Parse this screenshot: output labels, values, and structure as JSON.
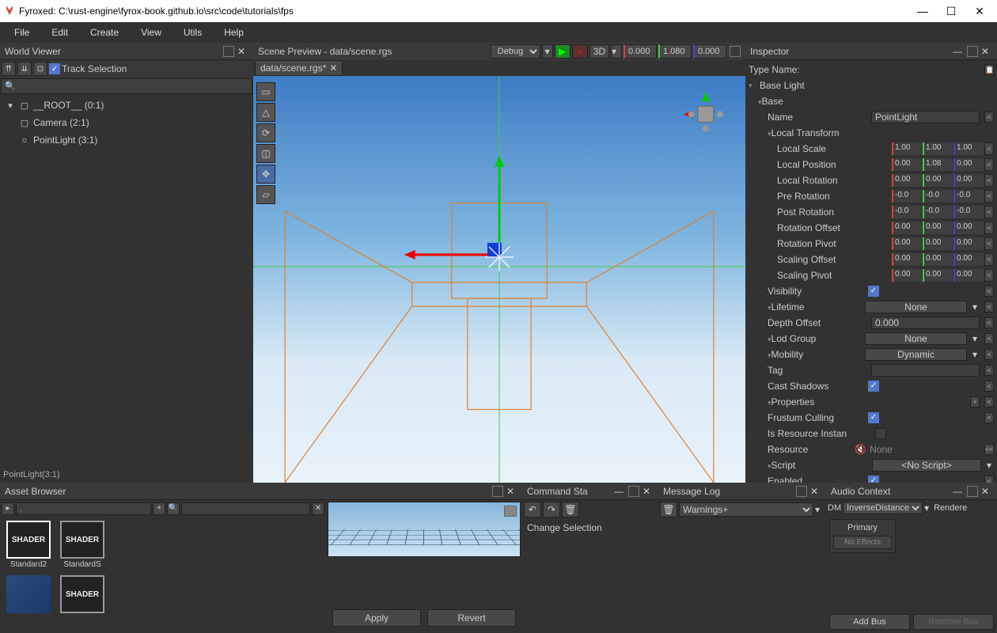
{
  "titlebar": {
    "title": "Fyroxed: C:\\rust-engine\\fyrox-book.github.io\\src\\code\\tutorials\\fps"
  },
  "menubar": {
    "items": [
      "File",
      "Edit",
      "Create",
      "View",
      "Utils",
      "Help"
    ]
  },
  "worldViewer": {
    "title": "World Viewer",
    "trackSelection": "Track Selection",
    "searchPlaceholder": "",
    "tree": {
      "root": "__ROOT__ (0:1)",
      "children": [
        {
          "icon": "cube",
          "label": "Camera (2:1)"
        },
        {
          "icon": "light",
          "label": "PointLight (3:1)"
        }
      ]
    },
    "status": "PointLight(3:1)"
  },
  "scene": {
    "title": "Scene Preview - data/scene.rgs",
    "buildConfig": "Debug",
    "mode": "3D",
    "pos": {
      "x": "0.000",
      "y": "1.080",
      "z": "0.000"
    },
    "tab": "data/scene.rgs*"
  },
  "inspector": {
    "title": "Inspector",
    "typeNameLabel": "Type Name:",
    "sections": {
      "baseLight": "Base Light",
      "base": "Base",
      "localTransform": "Local Transform",
      "lifetime": "Lifetime",
      "lodGroup": "Lod Group",
      "mobility": "Mobility",
      "properties": "Properties",
      "script": "Script"
    },
    "fields": {
      "name": {
        "label": "Name",
        "value": "PointLight"
      },
      "localScale": {
        "label": "Local Scale",
        "x": "1.00",
        "y": "1.00",
        "z": "1.00"
      },
      "localPosition": {
        "label": "Local Position",
        "x": "0.00",
        "y": "1.08",
        "z": "0.00"
      },
      "localRotation": {
        "label": "Local Rotation",
        "x": "0.00",
        "y": "0.00",
        "z": "0.00"
      },
      "preRotation": {
        "label": "Pre Rotation",
        "x": "-0.0",
        "y": "-0.0",
        "z": "-0.0"
      },
      "postRotation": {
        "label": "Post Rotation",
        "x": "-0.0",
        "y": "-0.0",
        "z": "-0.0"
      },
      "rotationOffset": {
        "label": "Rotation Offset",
        "x": "0.00",
        "y": "0.00",
        "z": "0.00"
      },
      "rotationPivot": {
        "label": "Rotation Pivot",
        "x": "0.00",
        "y": "0.00",
        "z": "0.00"
      },
      "scalingOffset": {
        "label": "Scaling Offset",
        "x": "0.00",
        "y": "0.00",
        "z": "0.00"
      },
      "scalingPivot": {
        "label": "Scaling Pivot",
        "x": "0.00",
        "y": "0.00",
        "z": "0.00"
      },
      "visibility": {
        "label": "Visibility"
      },
      "lifetimeVal": "None",
      "depthOffset": {
        "label": "Depth Offset",
        "value": "0.000"
      },
      "lodGroupVal": "None",
      "mobilityVal": "Dynamic",
      "tag": {
        "label": "Tag",
        "value": ""
      },
      "castShadows": {
        "label": "Cast Shadows"
      },
      "frustumCulling": {
        "label": "Frustum Culling"
      },
      "isResourceInstance": {
        "label": "Is Resource Instan"
      },
      "resource": {
        "label": "Resource",
        "value": "None"
      },
      "scriptVal": "<No Script>",
      "enabled": {
        "label": "Enabled"
      }
    }
  },
  "assetBrowser": {
    "title": "Asset Browser",
    "path": ".",
    "items": [
      {
        "label": "Standard2",
        "thumb": "SHADER"
      },
      {
        "label": "StandardS",
        "thumb": "SHADER"
      },
      {
        "label": "",
        "thumb": ""
      },
      {
        "label": "",
        "thumb": "SHADER"
      }
    ],
    "apply": "Apply",
    "revert": "Revert"
  },
  "commandStack": {
    "title": "Command Sta",
    "item": "Change Selection"
  },
  "messageLog": {
    "title": "Message Log",
    "filter": "Warnings+"
  },
  "audioContext": {
    "title": "Audio Context",
    "dmLabel": "DM",
    "dm": "InverseDistance",
    "renderer": "Rendere",
    "bus": {
      "name": "Primary",
      "noEffects": "No Effects"
    },
    "addBus": "Add Bus",
    "removeBus": "Remove Bus"
  }
}
